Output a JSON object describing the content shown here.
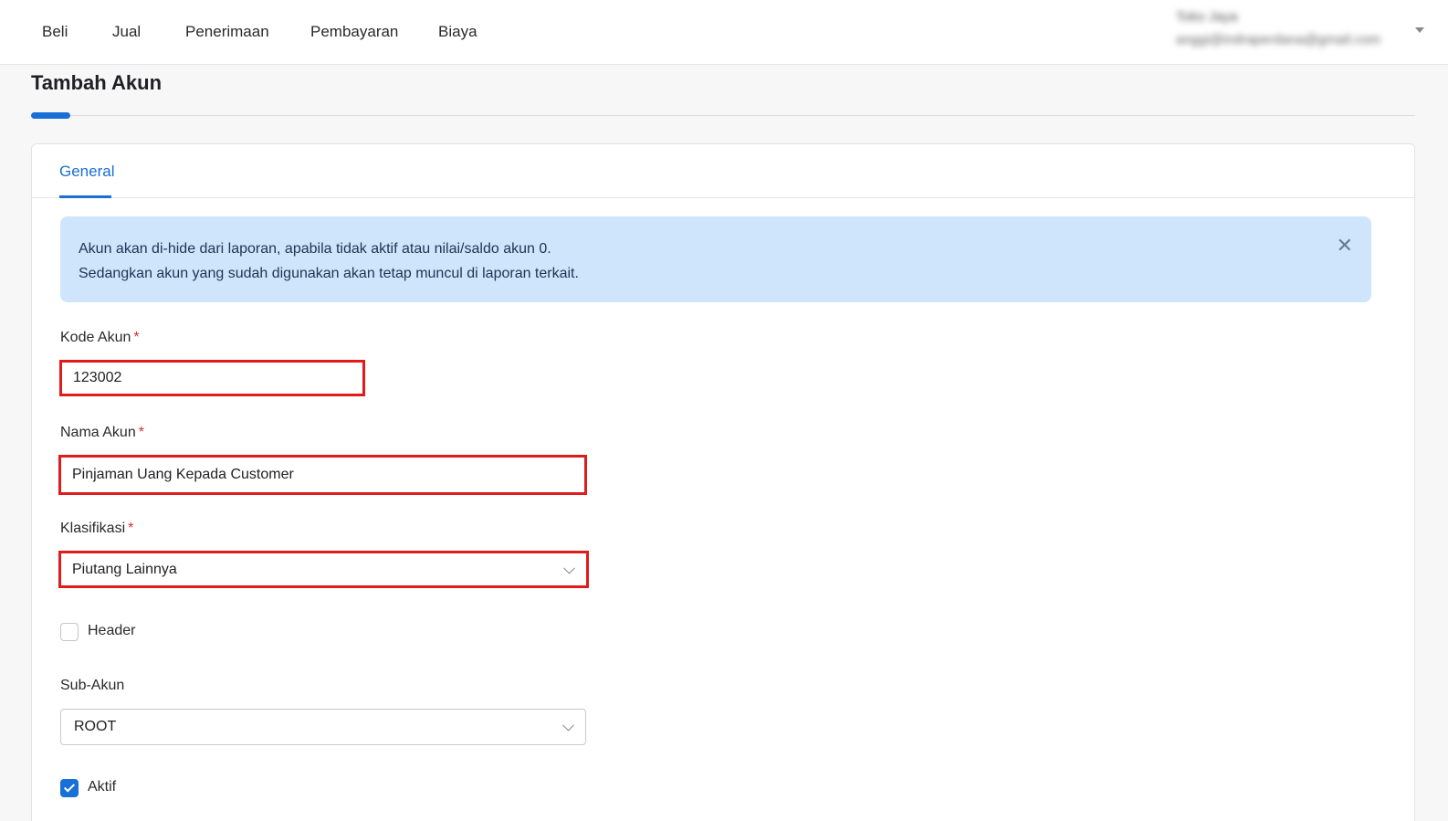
{
  "nav": {
    "items": [
      {
        "label": "Beli"
      },
      {
        "label": "Jual"
      },
      {
        "label": "Penerimaan"
      },
      {
        "label": "Pembayaran"
      },
      {
        "label": "Biaya"
      }
    ]
  },
  "user": {
    "name": "Toko Jaya",
    "email": "anggi@indraperdana@gmail.com"
  },
  "page": {
    "title": "Tambah Akun"
  },
  "tabs": [
    {
      "label": "General",
      "active": true
    }
  ],
  "alert": {
    "line1": "Akun akan di-hide dari laporan, apabila tidak aktif atau nilai/saldo akun 0.",
    "line2": "Sedangkan akun yang sudah digunakan akan tetap muncul di laporan terkait.",
    "close_icon": "close-icon"
  },
  "form": {
    "kode_akun": {
      "label": "Kode Akun",
      "required_mark": "*",
      "value": "123002"
    },
    "nama_akun": {
      "label": "Nama Akun",
      "required_mark": "*",
      "value": "Pinjaman Uang Kepada Customer"
    },
    "klasifikasi": {
      "label": "Klasifikasi",
      "required_mark": "*",
      "value": "Piutang Lainnya"
    },
    "header": {
      "label": "Header",
      "checked": false
    },
    "sub_akun": {
      "label": "Sub-Akun",
      "value": "ROOT"
    },
    "aktif": {
      "label": "Aktif",
      "checked": true
    }
  },
  "colors": {
    "accent": "#1870d6",
    "alert_bg": "#cfe5fb",
    "highlight": "#e01b1b",
    "required": "#d43030"
  }
}
